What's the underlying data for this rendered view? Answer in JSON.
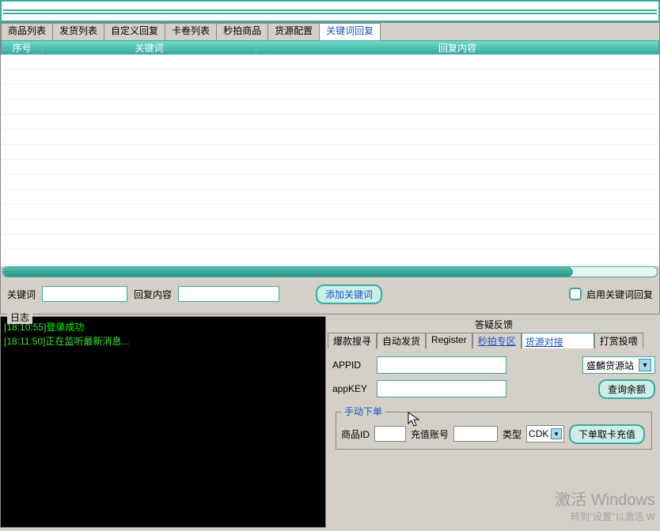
{
  "topbar": {},
  "tabs": {
    "items": [
      {
        "label": "商品列表"
      },
      {
        "label": "发货列表"
      },
      {
        "label": "自定义回复"
      },
      {
        "label": "卡卷列表"
      },
      {
        "label": "秒拍商品"
      },
      {
        "label": "货源配置"
      },
      {
        "label": "关键词回复"
      }
    ],
    "active_index": 6
  },
  "grid": {
    "col1": "序号",
    "col2": "关键词",
    "col3": "回复内容"
  },
  "inputs": {
    "keyword_label": "关键词",
    "reply_label": "回复内容",
    "add_button": "添加关键词",
    "enable_checkbox": "启用关键词回复"
  },
  "log": {
    "title": "日志",
    "lines": [
      {
        "ts": "[18:10:55]",
        "msg": "登录成功"
      },
      {
        "ts": "[18:11:50]",
        "msg": "正在监听最新消息..."
      }
    ]
  },
  "right": {
    "title": "答疑反馈",
    "tabs": [
      "爆款搜寻",
      "自动发货",
      "Register",
      "秒拍专区",
      "货源对接",
      "打赏投喂"
    ],
    "active_tab_index": 4,
    "appid_label": "APPID",
    "appkey_label": "appKEY",
    "source_select": "盛麟货源站",
    "balance_button": "查询余额",
    "manual": {
      "legend": "手动下单",
      "pid_label": "商品ID",
      "recharge_label": "充值账号",
      "type_label": "类型",
      "type_value": "CDK",
      "submit": "下单取卡充值"
    }
  },
  "watermark": {
    "l1": "激活 Windows",
    "l2": "转到\"设置\"以激活 W"
  }
}
